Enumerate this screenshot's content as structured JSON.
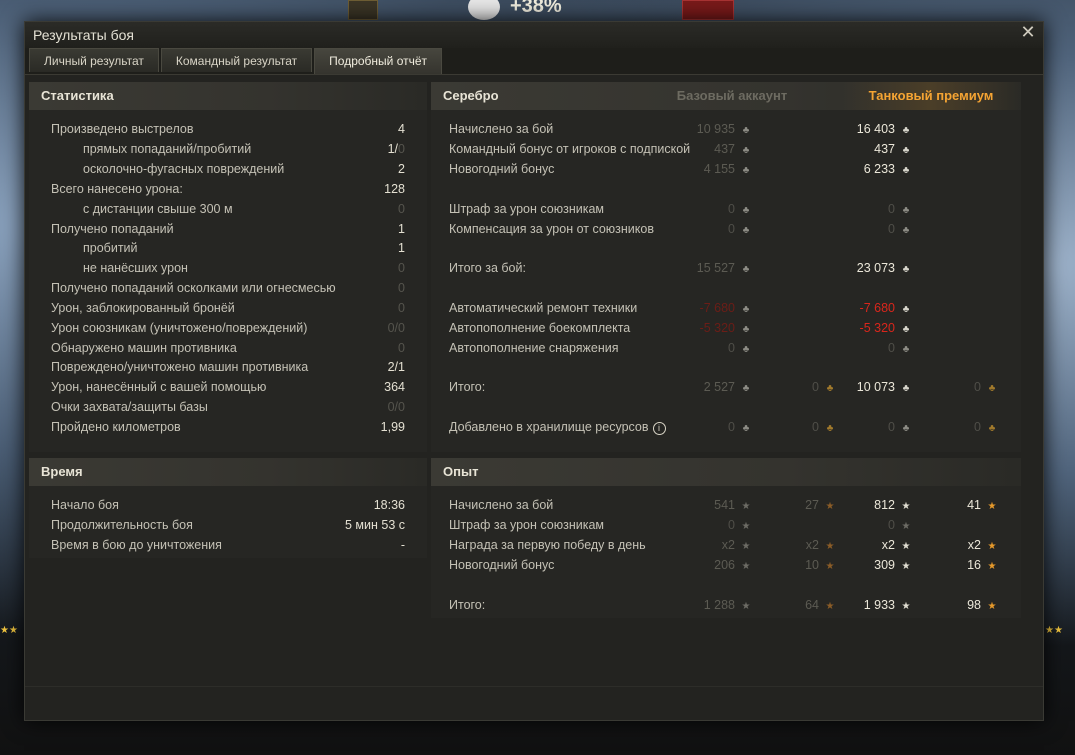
{
  "scene": {
    "top_bonus": "+38%"
  },
  "window": {
    "title": "Результаты боя",
    "close_glyph": "✕"
  },
  "tabs": [
    {
      "label": "Личный результат"
    },
    {
      "label": "Командный результат"
    },
    {
      "label": "Подробный отчёт"
    }
  ],
  "stats": {
    "header": "Статистика",
    "rows": [
      {
        "label": "Произведено выстрелов",
        "value": "4"
      },
      {
        "label": "прямых попаданий/пробитий",
        "value": "1/",
        "value_dim": "0"
      },
      {
        "label": "осколочно-фугасных повреждений",
        "value": "2"
      },
      {
        "label": "Всего нанесено урона:",
        "value": "128"
      },
      {
        "label": "с дистанции свыше 300 м",
        "value": "0"
      },
      {
        "label": "Получено попаданий",
        "value": "1"
      },
      {
        "label": "пробитий",
        "value": "1"
      },
      {
        "label": "не нанёсших урон",
        "value": "0"
      },
      {
        "label": "Получено попаданий осколками или огнесмесью",
        "value": "0"
      },
      {
        "label": "Урон, заблокированный бронёй",
        "value": "0"
      },
      {
        "label": "Урон союзникам (уничтожено/повреждений)",
        "value": "0/0"
      },
      {
        "label": "Обнаружено машин противника",
        "value": "0"
      },
      {
        "label": "Повреждено/уничтожено машин противника",
        "value": "2/1"
      },
      {
        "label": "Урон, нанесённый с вашей помощью",
        "value": "364"
      },
      {
        "label": "Очки захвата/защиты базы",
        "value": "0/0"
      },
      {
        "label": "Пройдено километров",
        "value": "1,99"
      }
    ]
  },
  "time": {
    "header": "Время",
    "rows": [
      {
        "label": "Начало боя",
        "value": "18:36"
      },
      {
        "label": "Продолжительность боя",
        "value": "5 мин 53 с"
      },
      {
        "label": "Время в бою до уничтожения",
        "value": "-"
      }
    ]
  },
  "silver": {
    "header": "Серебро",
    "col_base": "Базовый аккаунт",
    "col_premium": "Танковый премиум",
    "rows": [
      {
        "label": "Начислено за бой",
        "base": "10 935",
        "prem": "16 403"
      },
      {
        "label": "Командный бонус от игроков с подпиской",
        "base": "437",
        "prem": "437"
      },
      {
        "label": "Новогодний бонус",
        "base": "4 155",
        "prem": "6 233"
      },
      {
        "label": "Штраф за урон союзникам",
        "base": "0",
        "prem": "0"
      },
      {
        "label": "Компенсация за урон от союзников",
        "base": "0",
        "prem": "0"
      },
      {
        "label": "Итого за бой:",
        "base": "15 527",
        "prem": "23 073"
      },
      {
        "label": "Автоматический ремонт техники",
        "base": "-7 680",
        "prem": "-7 680"
      },
      {
        "label": "Автопополнение боекомплекта",
        "base": "-5 320",
        "prem": "-5 320"
      },
      {
        "label": "Автопополнение снаряжения",
        "base": "0",
        "prem": "0"
      },
      {
        "label": "Итого:",
        "base": "2 527",
        "base_gold": "0",
        "prem": "10 073",
        "prem_gold": "0"
      },
      {
        "label": "Добавлено в хранилище ресурсов",
        "base": "0",
        "base_gold": "0",
        "prem": "0",
        "prem_gold": "0"
      }
    ]
  },
  "exp": {
    "header": "Опыт",
    "rows": [
      {
        "label": "Начислено за бой",
        "base": "541",
        "base_free": "27",
        "prem": "812",
        "prem_free": "41"
      },
      {
        "label": "Штраф за урон союзникам",
        "base": "0",
        "prem": "0"
      },
      {
        "label": "Награда за первую победу в день",
        "base": "x2",
        "base_free": "x2",
        "prem": "x2",
        "prem_free": "x2"
      },
      {
        "label": "Новогодний бонус",
        "base": "206",
        "base_free": "10",
        "prem": "309",
        "prem_free": "16"
      },
      {
        "label": "Итого:",
        "base": "1 288",
        "base_free": "64",
        "prem": "1 933",
        "prem_free": "98"
      }
    ]
  },
  "icons": {
    "silver": "silver-coin-icon",
    "gold": "gold-coin-icon",
    "exp": "exp-star-icon",
    "free_exp": "free-exp-star-icon",
    "info": "info-icon"
  },
  "colors": {
    "premium": "#f5a433",
    "penalty": "#d9261c"
  }
}
